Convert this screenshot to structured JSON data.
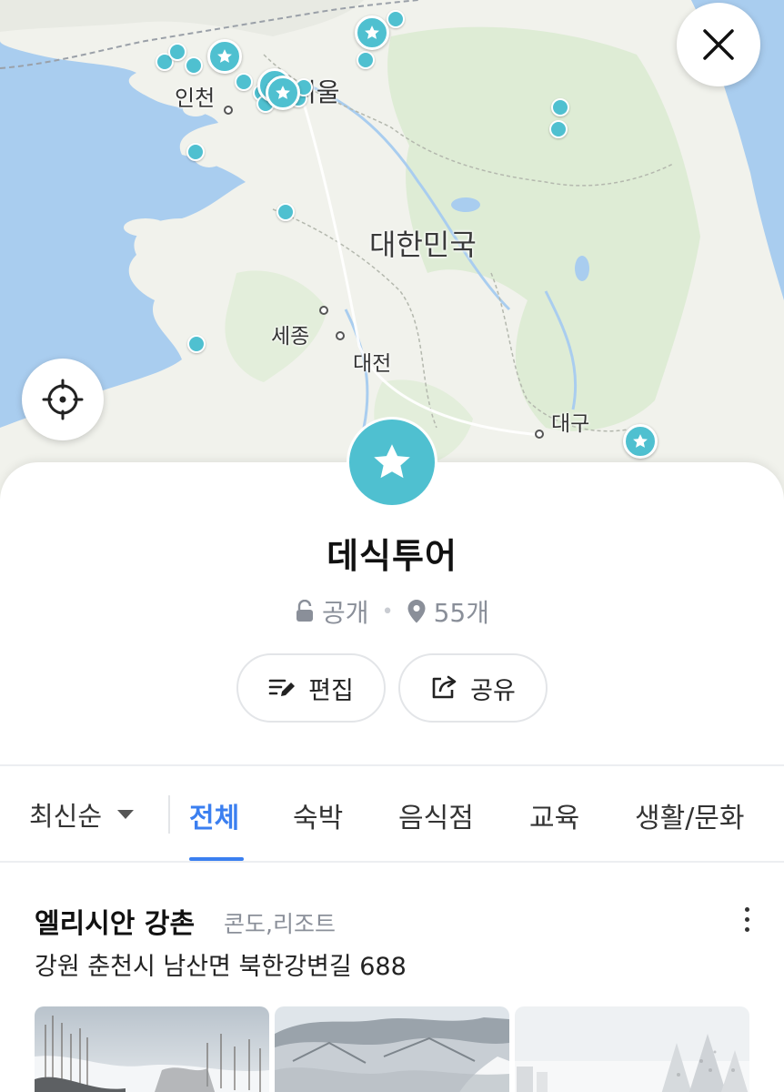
{
  "map": {
    "labels": {
      "seoul": "서울",
      "incheon": "인천",
      "country": "대한민국",
      "sejong": "세종",
      "daejeon": "대전",
      "daegu": "대구"
    }
  },
  "colors": {
    "pin": "#4fc0d0",
    "accent": "#3b7ff0",
    "water": "#a9cdef",
    "land": "#f1f2ec",
    "forest": "#dcebd3"
  },
  "icons": {
    "close": "close-icon",
    "locate": "crosshair-icon",
    "star": "star-icon",
    "lock": "lock-icon",
    "pin": "location-pin-icon",
    "edit": "edit-icon",
    "share": "share-icon",
    "dropdown": "caret-down-icon",
    "more": "more-vertical-icon"
  },
  "folder": {
    "title": "데식투어",
    "visibility": "공개",
    "count": "55개"
  },
  "actions": {
    "edit_label": "편집",
    "share_label": "공유"
  },
  "sort": {
    "label": "최신순"
  },
  "tabs": [
    {
      "label": "전체",
      "active": true
    },
    {
      "label": "숙박",
      "active": false
    },
    {
      "label": "음식점",
      "active": false
    },
    {
      "label": "교육",
      "active": false
    },
    {
      "label": "생활/문화",
      "active": false
    }
  ],
  "place": {
    "name": "엘리시안 강촌",
    "category": "콘도,리조트",
    "address": "강원 춘천시 남산면 북한강변길 688"
  }
}
